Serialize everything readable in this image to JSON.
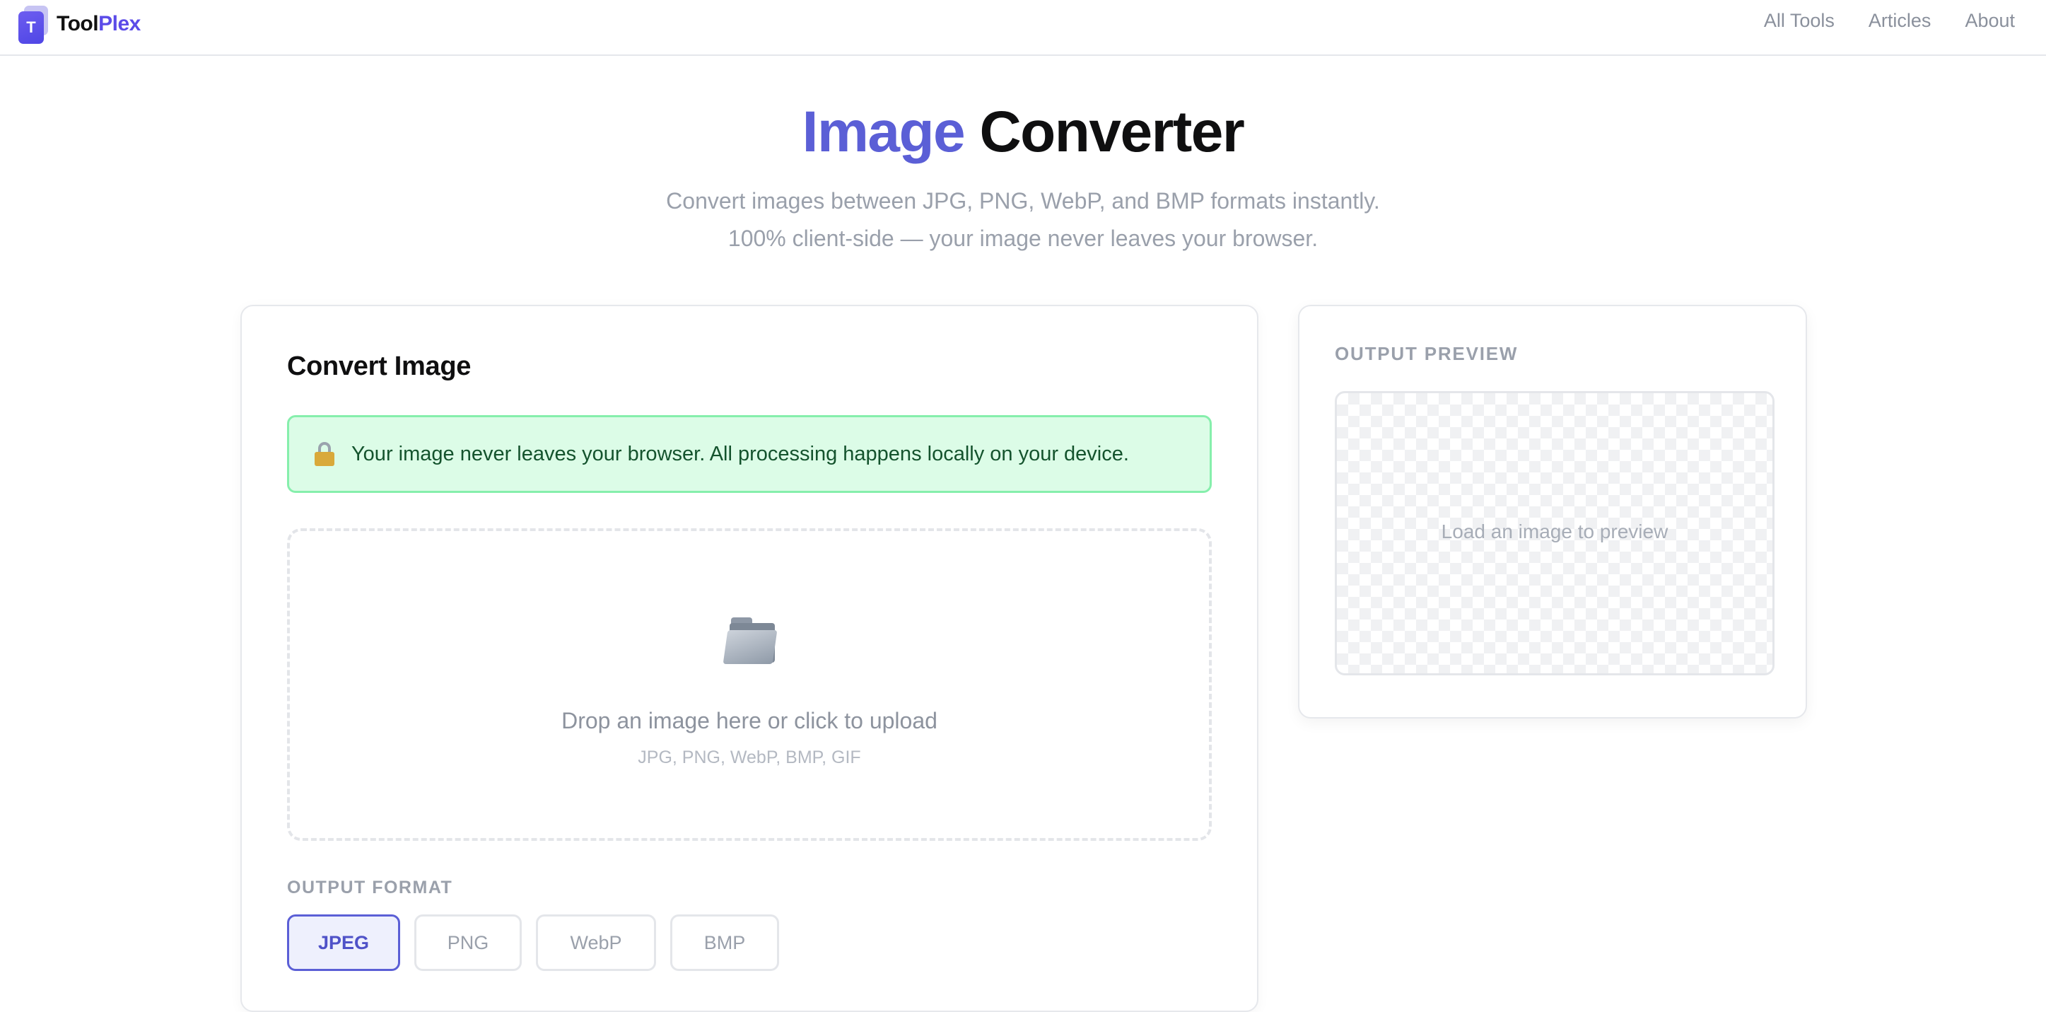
{
  "header": {
    "logo_letter": "T",
    "brand_part1": "Tool",
    "brand_part2": "Plex",
    "nav": [
      {
        "label": "All Tools"
      },
      {
        "label": "Articles"
      },
      {
        "label": "About"
      }
    ]
  },
  "hero": {
    "title_accent": "Image",
    "title_rest": "Converter",
    "subtitle_line1": "Convert images between JPG, PNG, WebP, and BMP formats instantly.",
    "subtitle_line2": "100% client-side — your image never leaves your browser."
  },
  "converter": {
    "title": "Convert Image",
    "notice": "Your image never leaves your browser. All processing happens locally on your device.",
    "notice_icon": "lock-icon",
    "dropzone": {
      "icon": "folder-icon",
      "title": "Drop an image here or click to upload",
      "types": "JPG, PNG, WebP, BMP, GIF"
    },
    "output_format_label": "OUTPUT FORMAT",
    "formats": [
      {
        "label": "JPEG",
        "selected": true
      },
      {
        "label": "PNG",
        "selected": false
      },
      {
        "label": "WebP",
        "selected": false
      },
      {
        "label": "BMP",
        "selected": false
      }
    ]
  },
  "preview": {
    "label": "OUTPUT PREVIEW",
    "empty_text": "Load an image to preview"
  },
  "colors": {
    "accent": "#5b5fd6",
    "brand": "#5b4be8",
    "notice_bg": "#dcfce7",
    "notice_border": "#86efac",
    "notice_text": "#14532d"
  }
}
